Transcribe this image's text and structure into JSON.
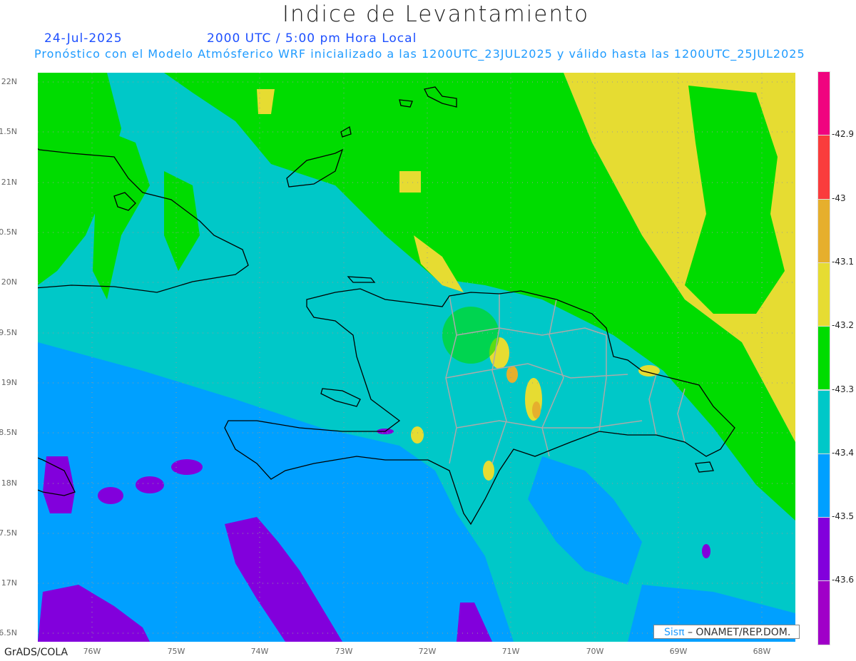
{
  "title": "Indice de Levantamiento",
  "date": "24-Jul-2025",
  "time": "2000 UTC / 5:00 pm Hora Local",
  "description": "Pronóstico con el Modelo Atmósferico WRF inicializado a las 1200UTC_23JUL2025 y válido hasta las  1200UTC_25JUL2025",
  "lat_labels": [
    "22N",
    "1.5N",
    "21N",
    "0.5N",
    "20N",
    "9.5N",
    "19N",
    "8.5N",
    "18N",
    "7.5N",
    "17N",
    "6.5N"
  ],
  "lon_labels": [
    "76W",
    "75W",
    "74W",
    "73W",
    "72W",
    "71W",
    "70W",
    "69W",
    "68W"
  ],
  "colorbar": {
    "colors": [
      "#f0047f",
      "#fa3c3c",
      "#e6af2d",
      "#e6dc32",
      "#00dc00",
      "#00c8c8",
      "#00a0ff",
      "#8200dc",
      "#a000c8"
    ],
    "labels": [
      "-42.9",
      "-43",
      "-43.1",
      "-43.2",
      "-43.3",
      "-43.4",
      "-43.5",
      "-43.6"
    ]
  },
  "credit": {
    "brand": "Sisπ",
    "rest": "– ONAMET/REP.DOM."
  },
  "footer": "GrADS/COLA"
}
